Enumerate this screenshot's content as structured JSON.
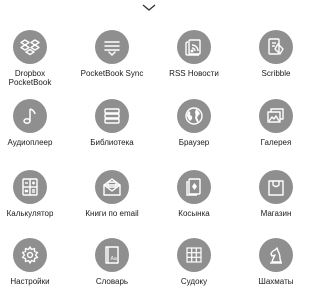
{
  "panel": {
    "handle_icon": "chevron-down-icon"
  },
  "apps": [
    {
      "label": "Dropbox\nPocketBook",
      "icon": "dropbox-icon"
    },
    {
      "label": "PocketBook Sync",
      "icon": "sync-icon"
    },
    {
      "label": "RSS Новости",
      "icon": "rss-news-icon"
    },
    {
      "label": "Scribble",
      "icon": "scribble-icon"
    },
    {
      "label": "Аудиоплеер",
      "icon": "music-note-icon"
    },
    {
      "label": "Библиотека",
      "icon": "library-books-icon"
    },
    {
      "label": "Браузер",
      "icon": "globe-icon"
    },
    {
      "label": "Галерея",
      "icon": "gallery-icon"
    },
    {
      "label": "Калькулятор",
      "icon": "calculator-icon"
    },
    {
      "label": "Книги по email",
      "icon": "email-book-icon"
    },
    {
      "label": "Косынка",
      "icon": "playing-card-icon"
    },
    {
      "label": "Магазин",
      "icon": "shopping-bag-icon"
    },
    {
      "label": "Настройки",
      "icon": "gear-icon"
    },
    {
      "label": "Словарь",
      "icon": "dictionary-icon"
    },
    {
      "label": "Судоку",
      "icon": "sudoku-grid-icon"
    },
    {
      "label": "Шахматы",
      "icon": "chess-knight-icon"
    }
  ],
  "colors": {
    "icon_bg": "#8f8f8f",
    "icon_fg": "#ffffff",
    "text": "#1a1a1a",
    "background": "#ffffff"
  }
}
